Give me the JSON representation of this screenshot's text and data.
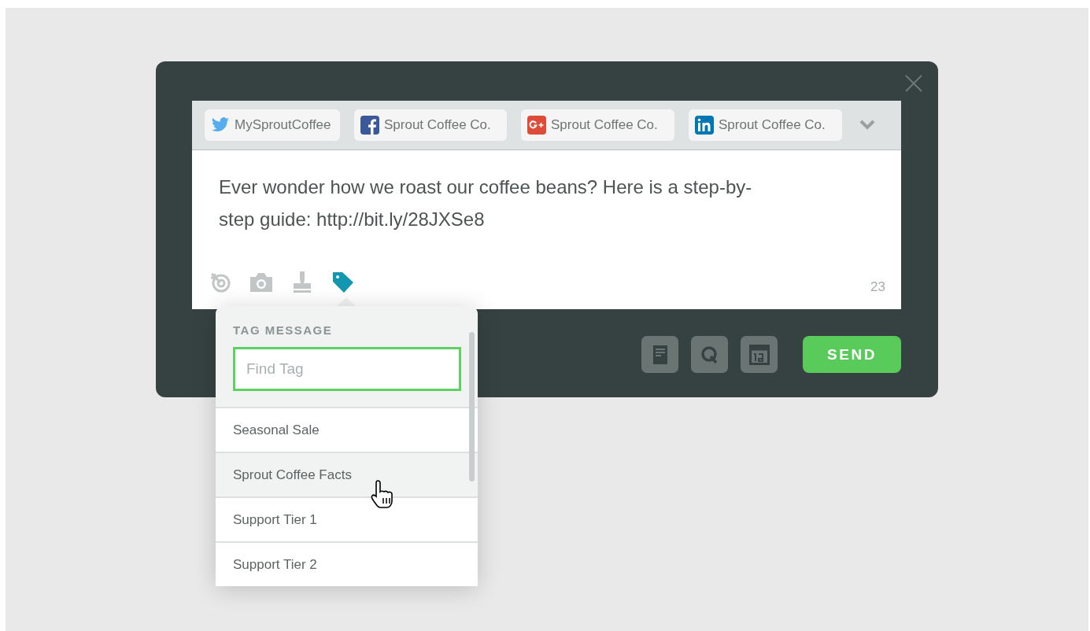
{
  "accounts": [
    {
      "kind": "twitter",
      "name": "MySproutCoffee"
    },
    {
      "kind": "facebook",
      "name": "Sprout Coffee Co."
    },
    {
      "kind": "googleplus",
      "name": "Sprout Coffee Co."
    },
    {
      "kind": "linkedin",
      "name": "Sprout Coffee Co."
    }
  ],
  "message": "Ever wonder how we roast our coffee beans? Here is a step-by-step guide: http://bit.ly/28JXSe8",
  "tools": [
    {
      "kind": "target",
      "selected": false
    },
    {
      "kind": "camera",
      "selected": false
    },
    {
      "kind": "stamp",
      "selected": false
    },
    {
      "kind": "tag",
      "selected": true
    }
  ],
  "char_count": "23",
  "actions": [
    {
      "kind": "notes"
    },
    {
      "kind": "search"
    },
    {
      "kind": "calendar"
    }
  ],
  "send_label": "SEND",
  "tag_popover": {
    "title": "TAG MESSAGE",
    "search_placeholder": "Find Tag",
    "items": [
      {
        "label": "Seasonal Sale",
        "highlighted": false
      },
      {
        "label": "Sprout Coffee Facts",
        "highlighted": true
      },
      {
        "label": "Support Tier 1",
        "highlighted": false
      },
      {
        "label": "Support Tier 2",
        "highlighted": false
      }
    ]
  }
}
